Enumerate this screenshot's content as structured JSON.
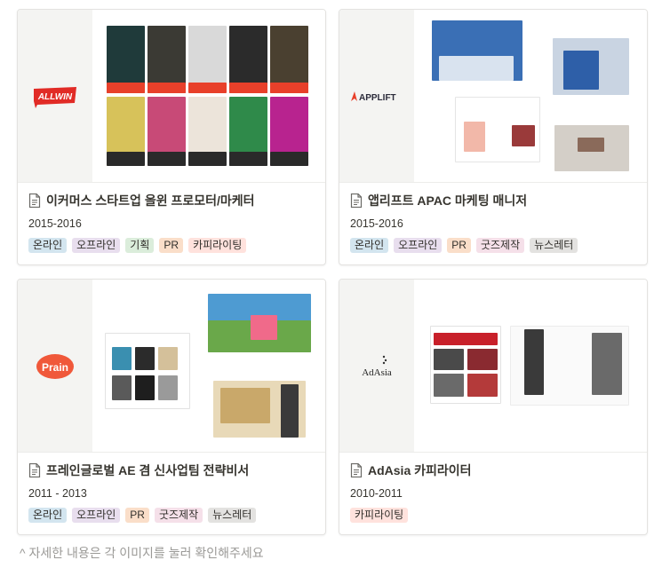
{
  "cards": [
    {
      "logo_text": "ALLWIN",
      "title": "이커머스 스타트업 올윈 프로모터/마케터",
      "period": "2015-2016",
      "tags": [
        {
          "label": "온라인",
          "color": "#d3e5ef"
        },
        {
          "label": "오프라인",
          "color": "#e8deee"
        },
        {
          "label": "기획",
          "color": "#dbeddb"
        },
        {
          "label": "PR",
          "color": "#fadec9"
        },
        {
          "label": "카피라이팅",
          "color": "#ffe2dd"
        }
      ]
    },
    {
      "logo_text": "APPLIFT",
      "title": "앱리프트 APAC 마케팅 매니저",
      "period": "2015-2016",
      "tags": [
        {
          "label": "온라인",
          "color": "#d3e5ef"
        },
        {
          "label": "오프라인",
          "color": "#e8deee"
        },
        {
          "label": "PR",
          "color": "#fadec9"
        },
        {
          "label": "굿즈제작",
          "color": "#f5e0e9"
        },
        {
          "label": "뉴스레터",
          "color": "#e3e2e0"
        }
      ]
    },
    {
      "logo_text": "Prain",
      "title": "프레인글로벌 AE 겸 신사업팀 전략비서",
      "period": "2011 - 2013",
      "tags": [
        {
          "label": "온라인",
          "color": "#d3e5ef"
        },
        {
          "label": "오프라인",
          "color": "#e8deee"
        },
        {
          "label": "PR",
          "color": "#fadec9"
        },
        {
          "label": "굿즈제작",
          "color": "#f5e0e9"
        },
        {
          "label": "뉴스레터",
          "color": "#e3e2e0"
        }
      ]
    },
    {
      "logo_text": "AdAsia",
      "title": "AdAsia 카피라이터",
      "period": "2010-2011",
      "tags": [
        {
          "label": "카피라이팅",
          "color": "#ffe2dd"
        }
      ]
    }
  ],
  "footer_note": "^ 자세한 내용은 각 이미지를 눌러 확인해주세요"
}
